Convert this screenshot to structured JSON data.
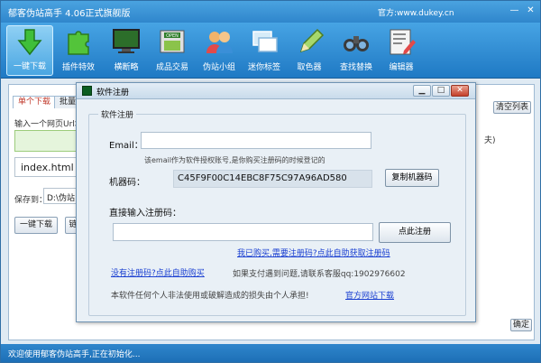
{
  "app": {
    "title": "郁客伪站高手 4.06正式旗舰版",
    "site": "官方:www.dukey.cn",
    "minimize": "—",
    "close": "✕"
  },
  "toolbar": [
    {
      "label": "一键下载",
      "icon": "download-arrow-icon",
      "color": "#3fbf3a"
    },
    {
      "label": "插件特效",
      "icon": "puzzle-icon",
      "color": "#53c43a"
    },
    {
      "label": "横断略",
      "icon": "monitor-icon",
      "color": "#2c6e2a"
    },
    {
      "label": "成品交易",
      "icon": "open-shop-icon",
      "color": "#e0e0e0"
    },
    {
      "label": "伪站小组",
      "icon": "users-icon",
      "color": "#f2b36a"
    },
    {
      "label": "迷你标签",
      "icon": "windows-icon",
      "color": "#d7ecf8"
    },
    {
      "label": "取色器",
      "icon": "pen-icon",
      "color": "#a6d86c"
    },
    {
      "label": "查找替换",
      "icon": "binoculars-icon",
      "color": "#3a3a3a"
    },
    {
      "label": "编辑器",
      "icon": "editor-icon",
      "color": "#f4f4f4"
    }
  ],
  "main": {
    "tab1": "单个下载",
    "tab2": "批量下",
    "url_hint": "输入一个网页Url地",
    "filename": "index.html",
    "save_label": "保存到：",
    "save_path": "D:\\伪站",
    "download_btn": "一键下载",
    "next_btn": "链",
    "clear_btn": "清空列表",
    "ok_btn": "确定",
    "edge_text": "夫)"
  },
  "status": "欢迎使用郁客伪站高手,正在初始化...",
  "dialog": {
    "title": "软件注册",
    "group_label": "软件注册",
    "email_label": "Email：",
    "email_value": "",
    "email_hint": "该email作为软件授权账号,是你购买注册码的时候登记的",
    "machine_label": "机器码：",
    "machine_code": "C45F9F00C14EBC8F75C97A96AD580",
    "copy_btn": "复制机器码",
    "regcode_label": "直接输入注册码：",
    "regcode_value": "",
    "register_btn": "点此注册",
    "link_bought": "我已购买,需要注册码?点此自助获取注册码",
    "link_buy": "没有注册码?点此自助购买",
    "support_text": "如果支付遇到问题,请联系客服qq:1902976602",
    "disclaimer": "本软件任何个人非法使用或破解造成的损失由个人承担!",
    "link_download": "官方网站下载"
  }
}
